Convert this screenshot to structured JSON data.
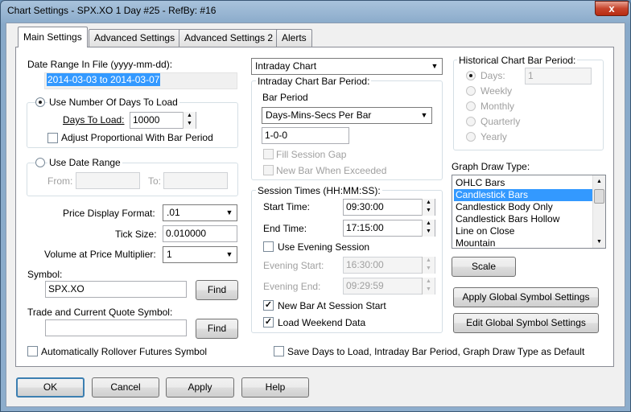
{
  "window": {
    "title": "Chart Settings - SPX.XO  1 Day   #25 - RefBy: #16",
    "close_glyph": "x"
  },
  "tabs": [
    {
      "label": "Main Settings"
    },
    {
      "label": "Advanced Settings"
    },
    {
      "label": "Advanced Settings 2"
    },
    {
      "label": "Alerts"
    }
  ],
  "left": {
    "date_range_label": "Date Range In File (yyyy-mm-dd):",
    "date_range_value": "2014-03-03 to 2014-03-07",
    "use_days_label": "Use Number Of Days To Load",
    "days_to_load_label": "Days To Load:",
    "days_to_load_value": "10000",
    "adjust_label": "Adjust Proportional With Bar Period",
    "use_date_range_label": "Use Date Range",
    "from_label": "From:",
    "to_label": "To:",
    "price_format_label": "Price Display Format:",
    "price_format_value": ".01",
    "tick_size_label": "Tick Size:",
    "tick_size_value": "0.010000",
    "volume_mult_label": "Volume at Price Multiplier:",
    "volume_mult_value": "1",
    "symbol_label": "Symbol:",
    "symbol_value": "SPX.XO",
    "find_label": "Find",
    "trade_quote_label": "Trade and Current Quote Symbol:",
    "trade_quote_value": "",
    "auto_rollover_label": "Automatically Rollover Futures Symbol"
  },
  "middle": {
    "chart_type_value": "Intraday Chart",
    "bar_period_group": "Intraday Chart Bar Period:",
    "bar_period_label": "Bar Period",
    "bar_period_type": "Days-Mins-Secs Per Bar",
    "bar_period_value": "1-0-0",
    "fill_gap_label": "Fill Session Gap",
    "new_bar_exceeded_label": "New Bar When Exceeded",
    "session_group": "Session Times (HH:MM:SS):",
    "start_time_label": "Start Time:",
    "start_time_value": "09:30:00",
    "end_time_label": "End Time:",
    "end_time_value": "17:15:00",
    "evening_session_label": "Use Evening Session",
    "evening_start_label": "Evening Start:",
    "evening_start_value": "16:30:00",
    "evening_end_label": "Evening End:",
    "evening_end_value": "09:29:59",
    "new_bar_session_label": "New Bar At Session Start",
    "weekend_label": "Load Weekend Data"
  },
  "right": {
    "hist_group": "Historical Chart Bar Period:",
    "hist_options": [
      "Days:",
      "Weekly",
      "Monthly",
      "Quarterly",
      "Yearly"
    ],
    "hist_days_value": "1",
    "graph_draw_label": "Graph Draw Type:",
    "graph_types": [
      "OHLC Bars",
      "Candlestick Bars",
      "Candlestick Body Only",
      "Candlestick Bars Hollow",
      "Line on Close",
      "Mountain"
    ],
    "scale_label": "Scale",
    "apply_global_label": "Apply Global Symbol Settings",
    "edit_global_label": "Edit Global Symbol Settings"
  },
  "save_default_label": "Save Days to Load, Intraday Bar Period, Graph Draw Type as Default",
  "footer": {
    "ok": "OK",
    "cancel": "Cancel",
    "apply": "Apply",
    "help": "Help"
  },
  "check_glyph": "✓",
  "arrow_down": "▼",
  "spin_up": "▲",
  "spin_down": "▼"
}
